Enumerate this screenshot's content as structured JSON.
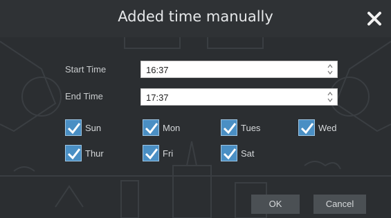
{
  "dialog": {
    "title": "Added time manually",
    "close_icon": "close-icon"
  },
  "form": {
    "start_label": "Start Time",
    "start_value": "16:37",
    "end_label": "End Time",
    "end_value": "17:37",
    "spin_icon": "spinner-arrows-icon"
  },
  "days": [
    {
      "label": "Sun",
      "checked": true
    },
    {
      "label": "Mon",
      "checked": true
    },
    {
      "label": "Tues",
      "checked": true
    },
    {
      "label": "Wed",
      "checked": true
    },
    {
      "label": "Thur",
      "checked": true
    },
    {
      "label": "Fri",
      "checked": true
    },
    {
      "label": "Sat",
      "checked": true
    }
  ],
  "buttons": {
    "ok_label": "OK",
    "cancel_label": "Cancel"
  },
  "colors": {
    "checkbox": "#4a8fc4",
    "checkmark": "#ffffff",
    "dialog_bg": "#2b2e31"
  }
}
